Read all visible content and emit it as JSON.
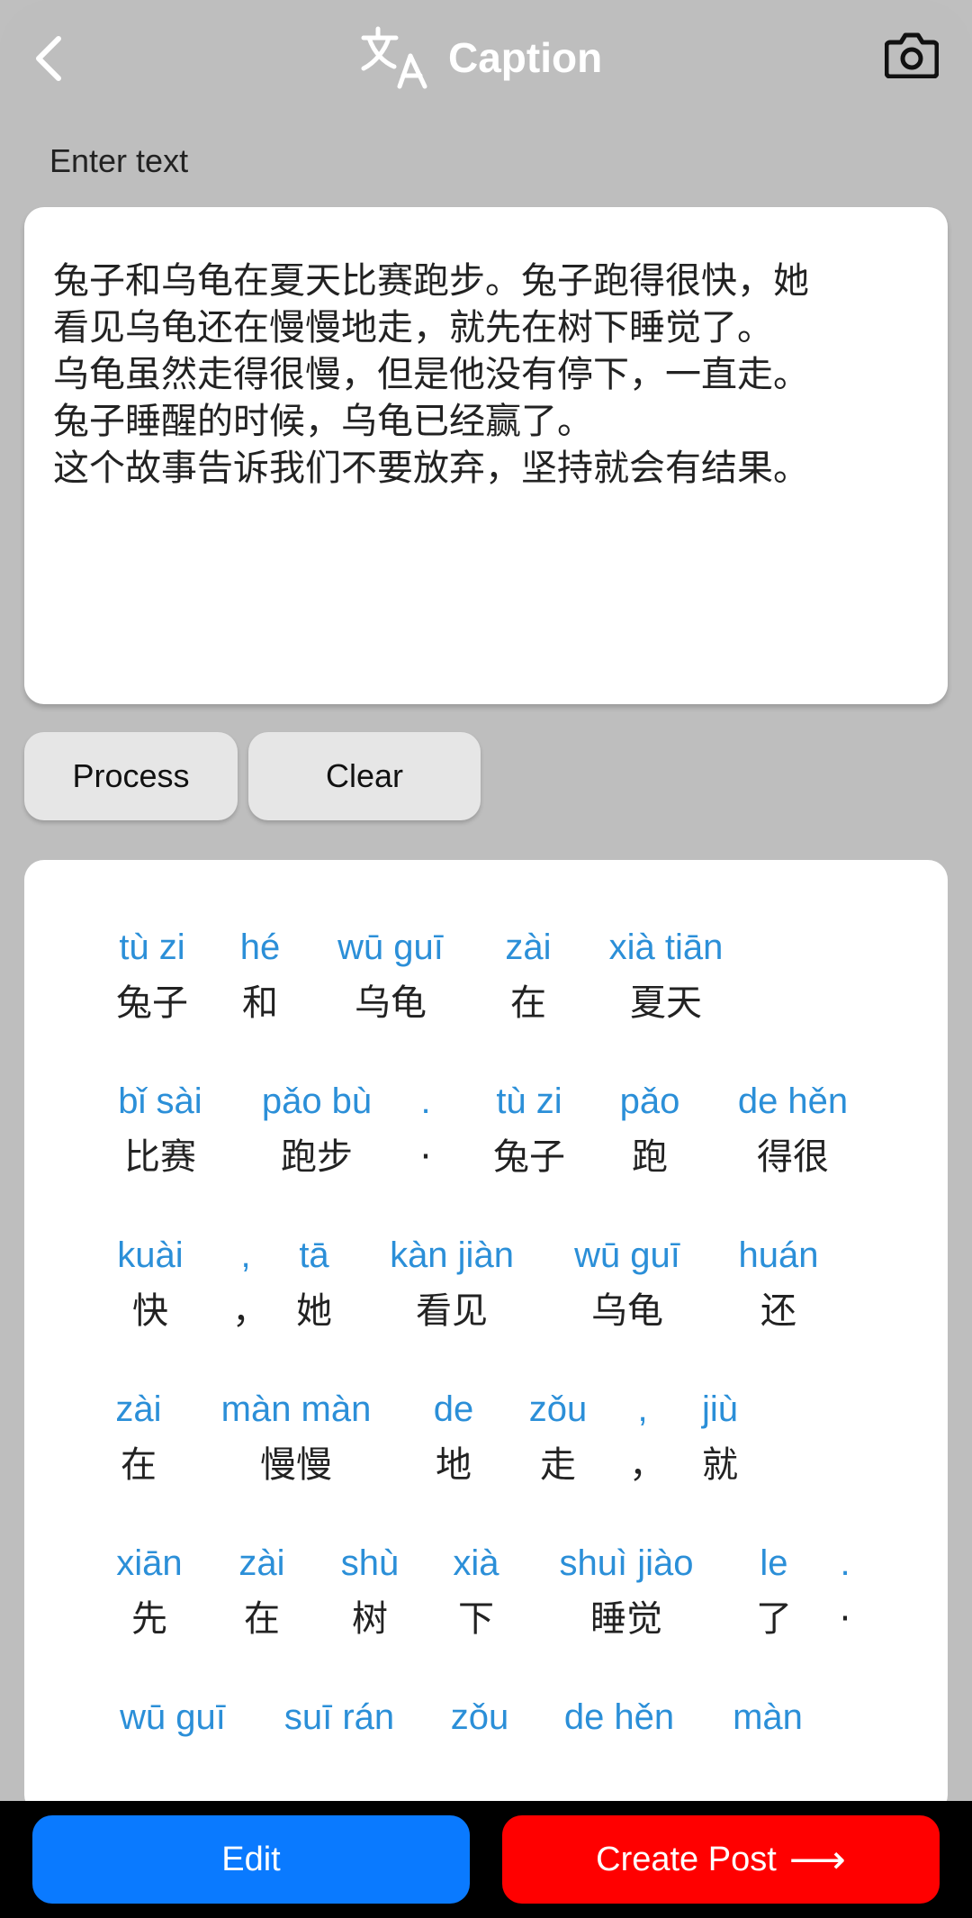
{
  "header": {
    "back_icon": "chevron-left-icon",
    "translate_icon": "translate-icon",
    "title": "Caption",
    "camera_icon": "camera-icon"
  },
  "input": {
    "label": "Enter text",
    "value": "兔子和乌龟在夏天比赛跑步。兔子跑得很快，她\n看见乌龟还在慢慢地走，就先在树下睡觉了。\n乌龟虽然走得很慢，但是他没有停下，一直走。\n兔子睡醒的时候，乌龟已经赢了。\n这个故事告诉我们不要放弃，坚持就会有结果。"
  },
  "actions": {
    "process": "Process",
    "clear": "Clear"
  },
  "result": {
    "rows": [
      [
        {
          "py": "tù zi",
          "hz": "兔子"
        },
        {
          "py": "hé",
          "hz": "和"
        },
        {
          "py": "wū guī",
          "hz": "乌龟"
        },
        {
          "py": "zài",
          "hz": "在"
        },
        {
          "py": "xià tiān",
          "hz": "夏天"
        }
      ],
      [
        {
          "py": "bǐ sài",
          "hz": "比赛"
        },
        {
          "py": "pǎo bù",
          "hz": "跑步"
        },
        {
          "py": ".",
          "hz": "·"
        },
        {
          "py": "tù zi",
          "hz": "兔子"
        },
        {
          "py": "pǎo",
          "hz": "跑"
        },
        {
          "py": "de hěn",
          "hz": "得很"
        }
      ],
      [
        {
          "py": "kuài",
          "hz": "快"
        },
        {
          "py": ",",
          "hz": "，"
        },
        {
          "py": "tā",
          "hz": "她"
        },
        {
          "py": "kàn jiàn",
          "hz": "看见"
        },
        {
          "py": "wū guī",
          "hz": "乌龟"
        },
        {
          "py": "huán",
          "hz": "还"
        }
      ],
      [
        {
          "py": "zài",
          "hz": "在"
        },
        {
          "py": "màn màn",
          "hz": "慢慢"
        },
        {
          "py": "de",
          "hz": "地"
        },
        {
          "py": "zǒu",
          "hz": "走"
        },
        {
          "py": ",",
          "hz": "，"
        },
        {
          "py": "jiù",
          "hz": "就"
        }
      ],
      [
        {
          "py": "xiān",
          "hz": "先"
        },
        {
          "py": "zài",
          "hz": "在"
        },
        {
          "py": "shù",
          "hz": "树"
        },
        {
          "py": "xià",
          "hz": "下"
        },
        {
          "py": "shuì jiào",
          "hz": "睡觉"
        },
        {
          "py": "le",
          "hz": "了"
        },
        {
          "py": ".",
          "hz": "·"
        }
      ],
      [
        {
          "py": "wū guī",
          "hz": ""
        },
        {
          "py": "suī rán",
          "hz": ""
        },
        {
          "py": "zǒu",
          "hz": ""
        },
        {
          "py": "de hěn",
          "hz": ""
        },
        {
          "py": "màn",
          "hz": ""
        }
      ]
    ]
  },
  "bottom": {
    "edit": "Edit",
    "create_post": "Create Post",
    "arrow_icon": "arrow-right-icon"
  },
  "colors": {
    "background": "#bebebe",
    "pinyin": "#2b8fd8",
    "edit_button": "#0a7aff",
    "post_button": "#ff0000"
  }
}
